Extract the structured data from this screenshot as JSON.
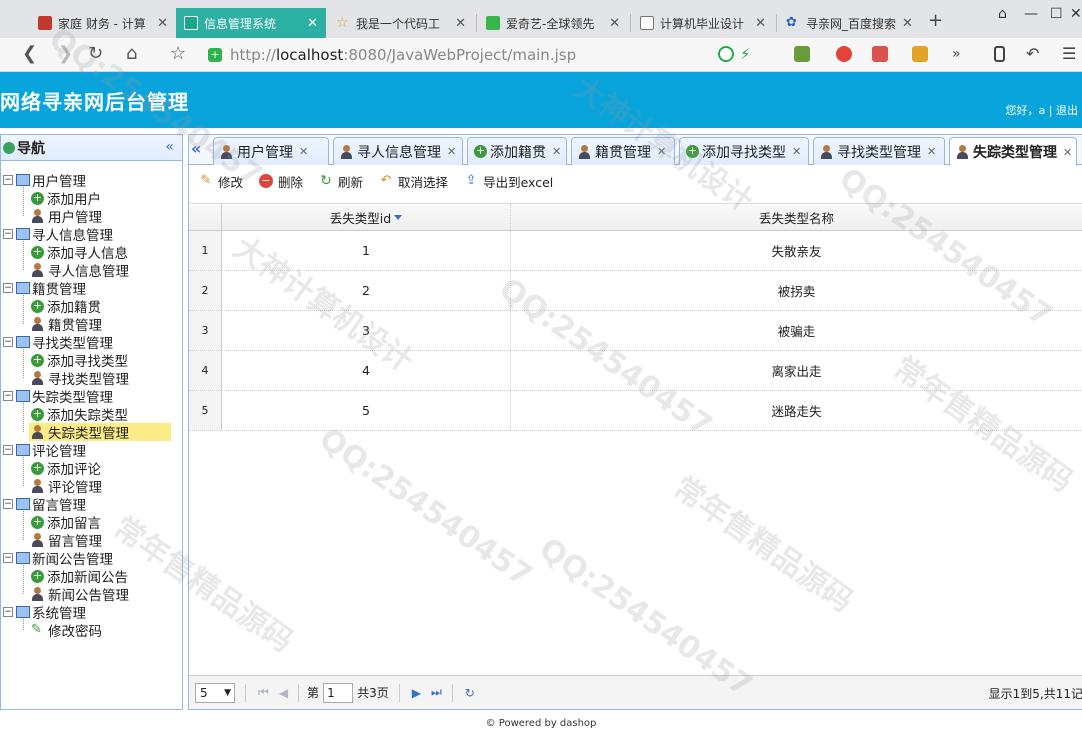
{
  "browser": {
    "tabs": [
      {
        "title": "家庭 财务 - 计算",
        "active": false
      },
      {
        "title": "信息管理系统",
        "active": true
      },
      {
        "title": "我是一个代码工",
        "active": false
      },
      {
        "title": "爱奇艺-全球领先",
        "active": false
      },
      {
        "title": "计算机毕业设计",
        "active": false
      },
      {
        "title": "寻亲网_百度搜索",
        "active": false
      }
    ],
    "url_prefix": "http://",
    "url_host": "localhost",
    "url_rest": ":8080/JavaWebProject/main.jsp"
  },
  "header": {
    "title": "网络寻亲网后台管理",
    "greeting": "您好，a | 退出"
  },
  "nav": {
    "title": "导航",
    "groups": [
      {
        "label": "用户管理",
        "children": [
          {
            "label": "添加用户",
            "icon": "add"
          },
          {
            "label": "用户管理",
            "icon": "user"
          }
        ]
      },
      {
        "label": "寻人信息管理",
        "children": [
          {
            "label": "添加寻人信息",
            "icon": "add"
          },
          {
            "label": "寻人信息管理",
            "icon": "user"
          }
        ]
      },
      {
        "label": "籍贯管理",
        "children": [
          {
            "label": "添加籍贯",
            "icon": "add"
          },
          {
            "label": "籍贯管理",
            "icon": "user"
          }
        ]
      },
      {
        "label": "寻找类型管理",
        "children": [
          {
            "label": "添加寻找类型",
            "icon": "add"
          },
          {
            "label": "寻找类型管理",
            "icon": "user"
          }
        ]
      },
      {
        "label": "失踪类型管理",
        "children": [
          {
            "label": "添加失踪类型",
            "icon": "add"
          },
          {
            "label": "失踪类型管理",
            "icon": "user"
          }
        ]
      },
      {
        "label": "评论管理",
        "children": [
          {
            "label": "添加评论",
            "icon": "add"
          },
          {
            "label": "评论管理",
            "icon": "user"
          }
        ]
      },
      {
        "label": "留言管理",
        "children": [
          {
            "label": "添加留言",
            "icon": "add"
          },
          {
            "label": "留言管理",
            "icon": "user"
          }
        ]
      },
      {
        "label": "新闻公告管理",
        "children": [
          {
            "label": "添加新闻公告",
            "icon": "add"
          },
          {
            "label": "新闻公告管理",
            "icon": "user"
          }
        ]
      },
      {
        "label": "系统管理",
        "children": [
          {
            "label": "修改密码",
            "icon": "pencil"
          }
        ]
      }
    ],
    "selected": "失踪类型管理"
  },
  "main": {
    "tabs": [
      {
        "label": "用户管理",
        "icon": "user"
      },
      {
        "label": "寻人信息管理",
        "icon": "user"
      },
      {
        "label": "添加籍贯",
        "icon": "add"
      },
      {
        "label": "籍贯管理",
        "icon": "user"
      },
      {
        "label": "添加寻找类型",
        "icon": "add"
      },
      {
        "label": "寻找类型管理",
        "icon": "user"
      },
      {
        "label": "失踪类型管理",
        "icon": "user",
        "active": true
      }
    ],
    "toolbar": {
      "edit": "修改",
      "delete": "删除",
      "refresh": "刷新",
      "cancel_select": "取消选择",
      "export": "导出到excel"
    },
    "grid": {
      "columns": [
        "丢失类型id",
        "丢失类型名称"
      ],
      "rows": [
        {
          "num": "1",
          "id": "1",
          "name": "失散亲友"
        },
        {
          "num": "2",
          "id": "2",
          "name": "被拐卖"
        },
        {
          "num": "3",
          "id": "3",
          "name": "被骗走"
        },
        {
          "num": "4",
          "id": "4",
          "name": "离家出走"
        },
        {
          "num": "5",
          "id": "5",
          "name": "迷路走失"
        }
      ]
    },
    "pager": {
      "page_size": "5",
      "page_label_before": "第",
      "page_value": "1",
      "page_label_after": "共3页",
      "info": "显示1到5,共11记"
    }
  },
  "footer": "© Powered by dashop",
  "watermarks": [
    "QQ:254540457",
    "大神计算机设计",
    "常年售精品源码"
  ]
}
